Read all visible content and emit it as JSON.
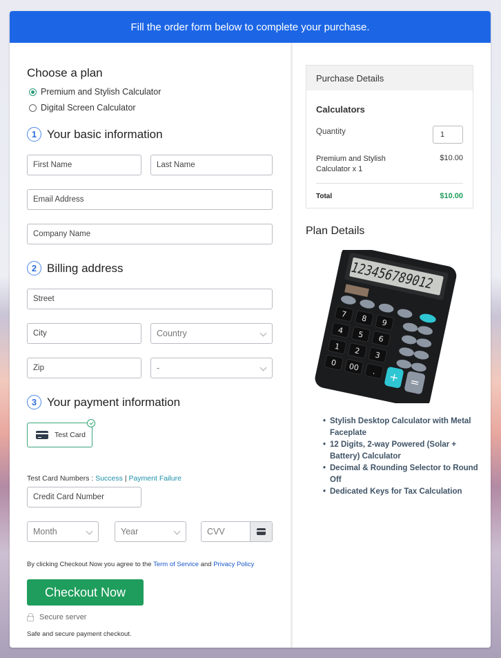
{
  "banner": {
    "text": "Fill the order form below to complete your purchase."
  },
  "plan": {
    "heading": "Choose a plan",
    "options": [
      {
        "label": "Premium and Stylish Calculator",
        "selected": true
      },
      {
        "label": "Digital Screen Calculator",
        "selected": false
      }
    ]
  },
  "basic_info": {
    "step": "1",
    "heading": "Your basic information",
    "first_name_placeholder": "First Name",
    "last_name_placeholder": "Last Name",
    "email_placeholder": "Email Address",
    "company_placeholder": "Company Name"
  },
  "billing": {
    "step": "2",
    "heading": "Billing address",
    "street_placeholder": "Street",
    "city_placeholder": "City",
    "country_selected": "Country",
    "zip_placeholder": "Zip",
    "state_selected": "-"
  },
  "payment": {
    "step": "3",
    "heading": "Your payment information",
    "method_label": "Test Card",
    "test_numbers_label": "Test Card Numbers :",
    "success_link": "Success",
    "separator": "|",
    "failure_link": "Payment Failure",
    "card_number_placeholder": "Credit Card Number",
    "month_selected": "Month",
    "year_selected": "Year",
    "cvv_placeholder": "CVV"
  },
  "terms": {
    "prefix": "By clicking Checkout Now you agree to the",
    "tos_link": "Term of Service",
    "and": "and",
    "privacy_link": "Privacy Policy"
  },
  "checkout": {
    "button_label": "Checkout Now",
    "secure_label": "Secure server",
    "safe_text": "Safe and secure payment checkout."
  },
  "purchase_details": {
    "header": "Purchase Details",
    "product_group": "Calculators",
    "quantity_label": "Quantity",
    "quantity_value": "1",
    "item_label": "Premium and Stylish Calculator x 1",
    "item_price": "$10.00",
    "total_label": "Total",
    "total_value": "$10.00"
  },
  "plan_details": {
    "heading": "Plan Details",
    "display_digits": "123456789012",
    "features": [
      "Stylish Desktop Calculator with Metal Faceplate",
      "12 Digits, 2-way Powered (Solar + Battery) Calculator",
      "Decimal & Rounding Selector to Round Off",
      "Dedicated Keys for Tax Calculation"
    ]
  },
  "colors": {
    "banner_blue": "#1c66e6",
    "checkout_green": "#1f9d5c",
    "link_teal": "#1b8fa8",
    "link_blue": "#1a58c8"
  }
}
